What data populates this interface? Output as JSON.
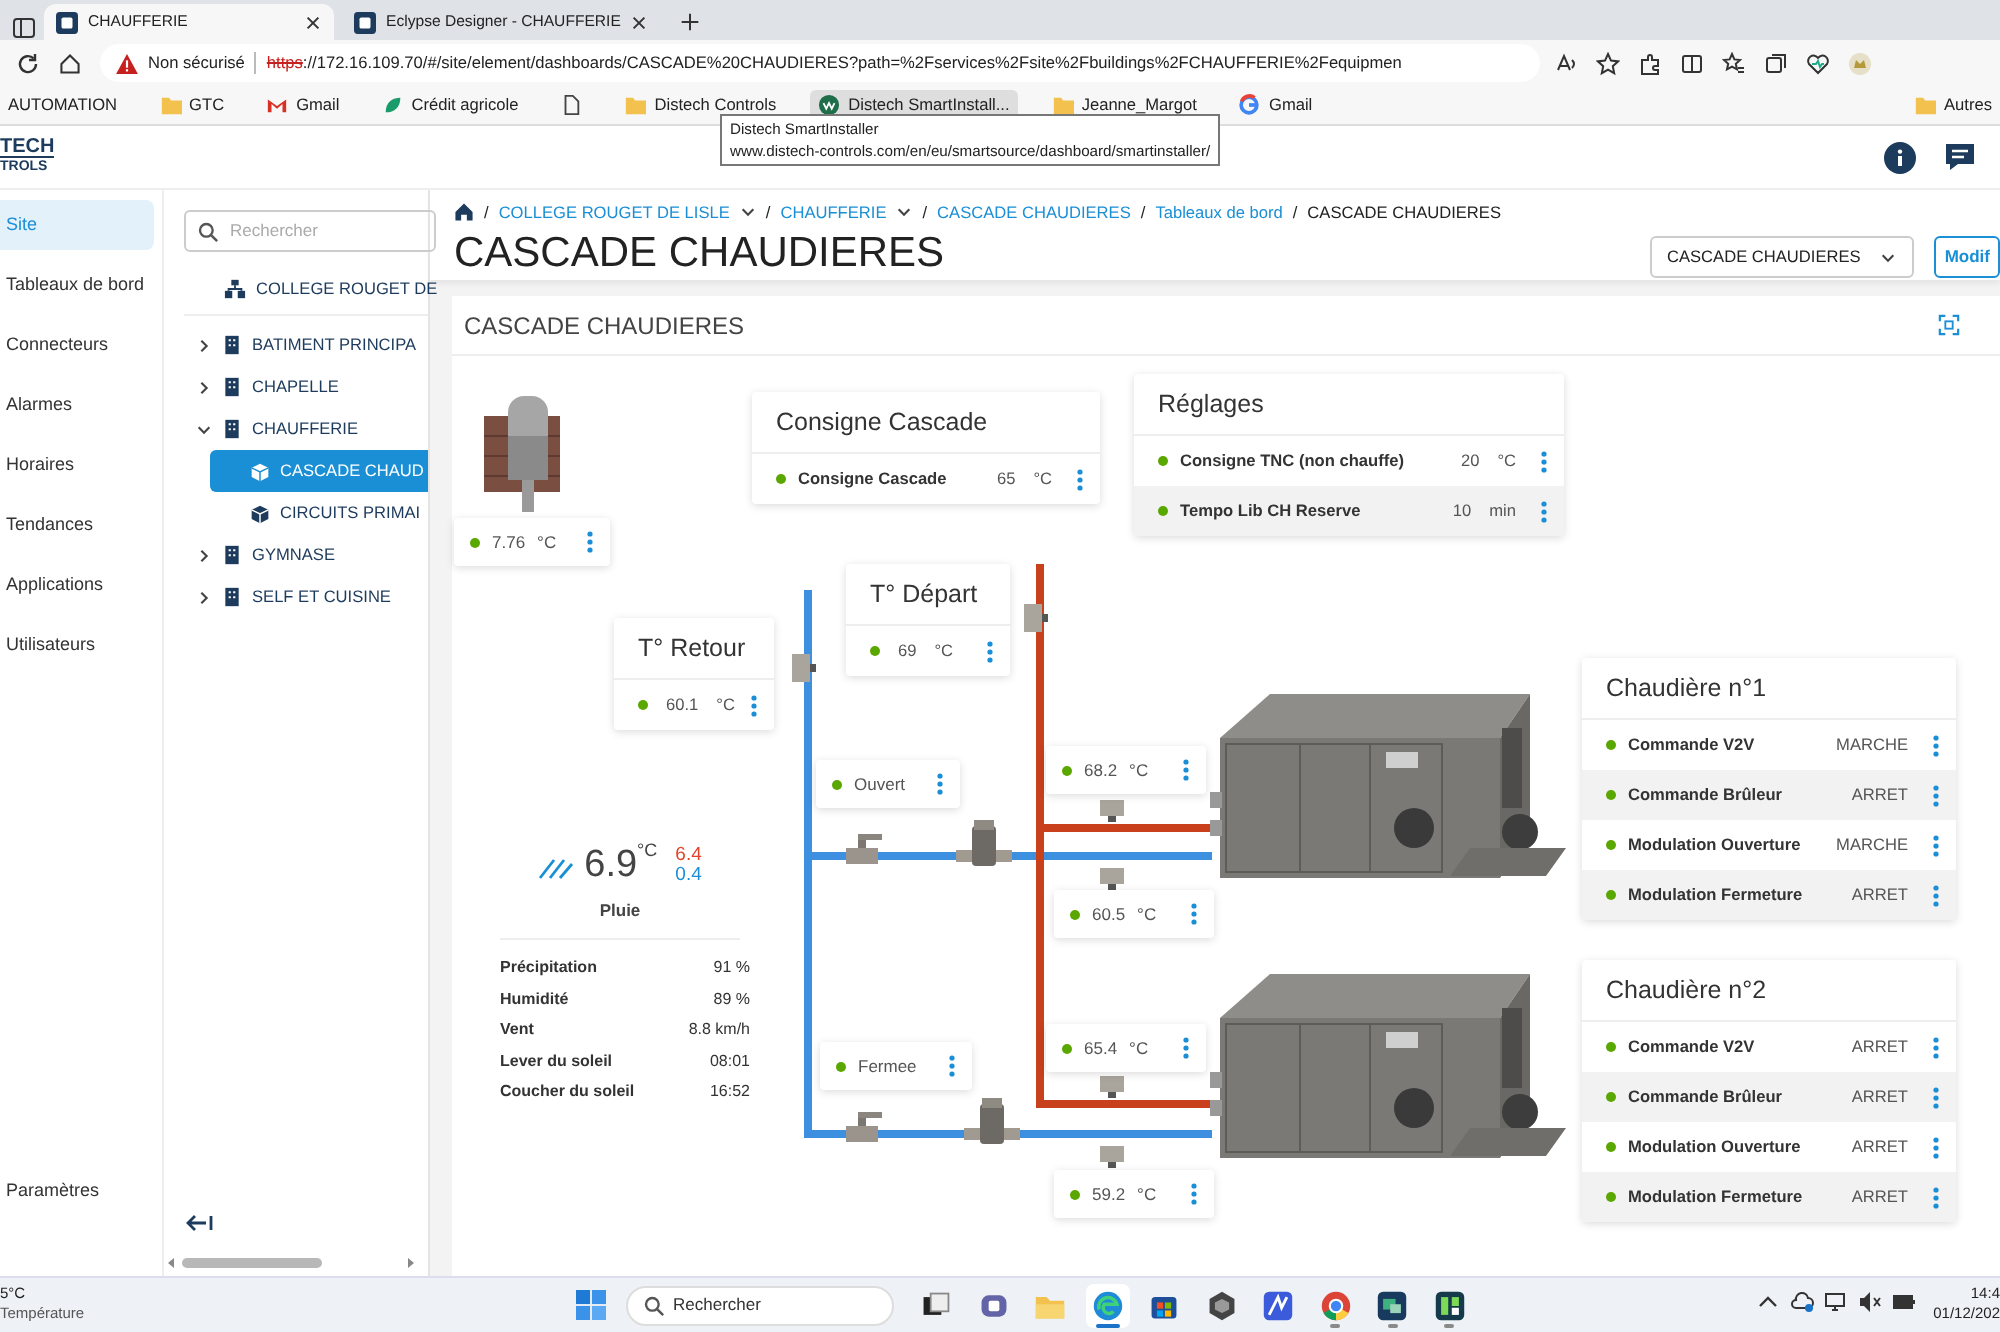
{
  "browser": {
    "tabs": [
      {
        "title": "CHAUFFERIE",
        "selected": true
      },
      {
        "title": "Eclypse Designer - CHAUFFERIE",
        "selected": false
      }
    ],
    "security_label": "Non sécurisé",
    "url_scheme": "https",
    "url_rest": "://172.16.109.70/#/site/element/dashboards/CASCADE%20CHAUDIERES?path=%2Fservices%2Fsite%2Fbuildings%2FCHAUFFERIE%2Fequipmen",
    "bookmarks": [
      {
        "label": "AUTOMATION",
        "kind": "plain",
        "hover": false
      },
      {
        "label": "GTC",
        "kind": "folder",
        "hover": false
      },
      {
        "label": "Gmail",
        "kind": "gmail",
        "hover": false
      },
      {
        "label": "Crédit agricole",
        "kind": "bank",
        "hover": false
      },
      {
        "kind": "page",
        "hover": false
      },
      {
        "label": "Distech Controls",
        "kind": "folder",
        "hover": false
      },
      {
        "label": "Distech SmartInstall...",
        "kind": "distech",
        "hover": true
      },
      {
        "label": "Jeanne_Margot",
        "kind": "folder",
        "hover": false
      },
      {
        "label": "Gmail",
        "kind": "google",
        "hover": false
      }
    ],
    "other_bookmarks": "Autres",
    "tooltip": {
      "title": "Distech SmartInstaller",
      "url": "www.distech-controls.com/en/eu/smartsource/dashboard/smartinstaller/"
    }
  },
  "app": {
    "logo_lines": [
      "TECH",
      "TROLS"
    ]
  },
  "nav": {
    "items": [
      {
        "label": "Site",
        "selected": true
      },
      {
        "label": "Tableaux de bord",
        "selected": false
      },
      {
        "label": "Connecteurs",
        "selected": false
      },
      {
        "label": "Alarmes",
        "selected": false
      },
      {
        "label": "Horaires",
        "selected": false
      },
      {
        "label": "Tendances",
        "selected": false
      },
      {
        "label": "Applications",
        "selected": false
      },
      {
        "label": "Utilisateurs",
        "selected": false
      }
    ],
    "settings": "Paramètres"
  },
  "tree": {
    "placeholder": "Rechercher",
    "root": "COLLEGE ROUGET DE",
    "items": [
      {
        "label": "BATIMENT PRINCIPA",
        "expanded": false,
        "selected": false
      },
      {
        "label": "CHAPELLE",
        "expanded": false,
        "selected": false
      },
      {
        "label": "CHAUFFERIE",
        "expanded": true,
        "selected": false,
        "children": [
          {
            "label": "CASCADE CHAUD",
            "selected": true
          },
          {
            "label": "CIRCUITS PRIMAI",
            "selected": false
          }
        ]
      },
      {
        "label": "GYMNASE",
        "expanded": false,
        "selected": false
      },
      {
        "label": "SELF ET CUISINE",
        "expanded": false,
        "selected": false
      }
    ]
  },
  "page": {
    "breadcrumb": [
      {
        "sep": "/",
        "label": "COLLEGE ROUGET DE LISLE",
        "dropdown": true,
        "current": false
      },
      {
        "sep": "/",
        "label": "CHAUFFERIE",
        "dropdown": true,
        "current": false
      },
      {
        "sep": "/",
        "label": "CASCADE CHAUDIERES",
        "dropdown": false,
        "current": false
      },
      {
        "sep": "/",
        "label": "Tableaux de bord",
        "dropdown": false,
        "current": false
      },
      {
        "sep": "/",
        "label": "CASCADE CHAUDIERES",
        "dropdown": false,
        "current": true
      }
    ],
    "title": "CASCADE CHAUDIERES",
    "dashboard_select": "CASCADE CHAUDIERES",
    "edit_button": "Modif"
  },
  "dashboard": {
    "title": "CASCADE CHAUDIERES",
    "widgets": [
      {
        "kind": "value",
        "value": "7.76",
        "unit": "°C"
      },
      {
        "kind": "panel",
        "title": "Consigne Cascade",
        "rows": [
          {
            "label": "Consigne Cascade",
            "value": "65",
            "unit": "°C"
          }
        ]
      },
      {
        "kind": "panel",
        "title": "Réglages",
        "rows": [
          {
            "label": "Consigne TNC (non chauffe)",
            "value": "20",
            "unit": "°C"
          },
          {
            "label": "Tempo Lib CH Reserve",
            "value": "10",
            "unit": "min"
          }
        ]
      },
      {
        "kind": "panel",
        "title": "T° Départ",
        "rows": [
          {
            "value": "69",
            "unit": "°C"
          }
        ]
      },
      {
        "kind": "panel",
        "title": "T° Retour",
        "rows": [
          {
            "value": "60.1",
            "unit": "°C"
          }
        ]
      },
      {
        "kind": "value",
        "value": "Ouvert"
      },
      {
        "kind": "value",
        "value": "68.2",
        "unit": "°C"
      },
      {
        "kind": "weather",
        "temperature": "6.9",
        "unit": "°C",
        "high": "6.4",
        "low": "0.4",
        "condition": "Pluie",
        "rows": [
          {
            "label": "Précipitation",
            "value": "91 %"
          },
          {
            "label": "Humidité",
            "value": "89 %"
          },
          {
            "label": "Vent",
            "value": "8.8 km/h"
          },
          {
            "label": "Lever du soleil",
            "value": "08:01"
          },
          {
            "label": "Coucher du soleil",
            "value": "16:52"
          }
        ]
      },
      {
        "kind": "value",
        "value": "60.5",
        "unit": "°C"
      },
      {
        "kind": "panel",
        "title": "Chaudière n°1",
        "rows": [
          {
            "label": "Commande V2V",
            "value": "MARCHE"
          },
          {
            "label": "Commande Brûleur",
            "value": "ARRET"
          },
          {
            "label": "Modulation Ouverture",
            "value": "MARCHE"
          },
          {
            "label": "Modulation Fermeture",
            "value": "ARRET"
          }
        ]
      },
      {
        "kind": "value",
        "value": "Fermee"
      },
      {
        "kind": "value",
        "value": "65.4",
        "unit": "°C"
      },
      {
        "kind": "value",
        "value": "59.2",
        "unit": "°C"
      },
      {
        "kind": "panel",
        "title": "Chaudière n°2",
        "rows": [
          {
            "label": "Commande V2V",
            "value": "ARRET"
          },
          {
            "label": "Commande Brûleur",
            "value": "ARRET"
          },
          {
            "label": "Modulation Ouverture",
            "value": "ARRET"
          },
          {
            "label": "Modulation Fermeture",
            "value": "ARRET"
          }
        ]
      }
    ]
  },
  "taskbar": {
    "weather_temp": "5°C",
    "weather_label": "Température",
    "search_placeholder": "Rechercher",
    "apps": [
      {
        "kind": "taskview",
        "open": false,
        "selected": false
      },
      {
        "kind": "chat",
        "open": false,
        "selected": false
      },
      {
        "kind": "files",
        "open": false,
        "selected": false
      },
      {
        "kind": "edge",
        "open": true,
        "selected": true
      },
      {
        "kind": "store",
        "open": false,
        "selected": false
      },
      {
        "kind": "hex",
        "open": false,
        "selected": false
      },
      {
        "kind": "editor",
        "open": false,
        "selected": false
      },
      {
        "kind": "chrome",
        "open": true,
        "selected": false
      },
      {
        "kind": "remote",
        "open": true,
        "selected": false
      },
      {
        "kind": "monitor",
        "open": true,
        "selected": false
      }
    ],
    "time": "14:4",
    "date": "01/12/202"
  }
}
